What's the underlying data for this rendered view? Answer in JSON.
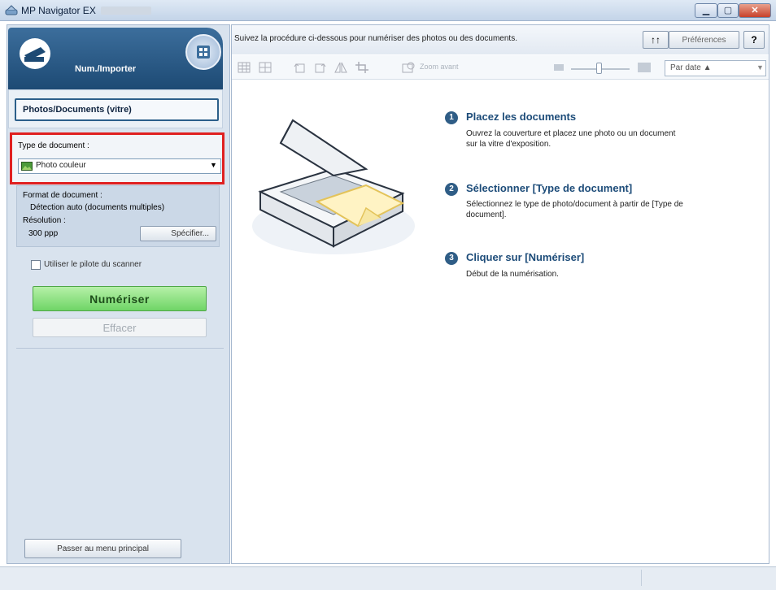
{
  "window": {
    "title": "MP Navigator EX",
    "min_icon": "minimize-icon",
    "max_icon": "maximize-icon",
    "close_icon": "close-icon"
  },
  "mode": {
    "title": "Num./Importer",
    "source_button": "Photos/Documents (vitre)"
  },
  "document_type": {
    "label": "Type de document :",
    "selected": "Photo couleur"
  },
  "settings": {
    "format_label": "Format de document :",
    "format_value": "Détection auto (documents multiples)",
    "resolution_label": "Résolution :",
    "resolution_value": "300 ppp",
    "specify_button": "Spécifier..."
  },
  "driver": {
    "label": "Utiliser le pilote du scanner",
    "checked": false
  },
  "actions": {
    "scan_button": "Numériser",
    "clear_button": "Effacer",
    "main_menu_button": "Passer au menu principal"
  },
  "header": {
    "instruction": "Suivez la procédure ci-dessous pour numériser des photos ou des documents.",
    "sort_icon_label": "↑↑",
    "preferences_button": "Préférences",
    "help_button": "?"
  },
  "toolbar": {
    "zoom_label": "Zoom avant",
    "sort_selected": "Par date ▲"
  },
  "steps": [
    {
      "num": "1",
      "title": "Placez les documents",
      "desc": "Ouvrez la couverture et placez une photo ou un document sur la vitre d'exposition."
    },
    {
      "num": "2",
      "title": "Sélectionner [Type de document]",
      "desc": "Sélectionnez le type de photo/document à partir de [Type de document]."
    },
    {
      "num": "3",
      "title": "Cliquer sur [Numériser]",
      "desc": "Début de la numérisation."
    }
  ],
  "colors": {
    "accent_blue": "#2f5d86",
    "highlight_red": "#e02020",
    "scan_green": "#6fd566"
  }
}
